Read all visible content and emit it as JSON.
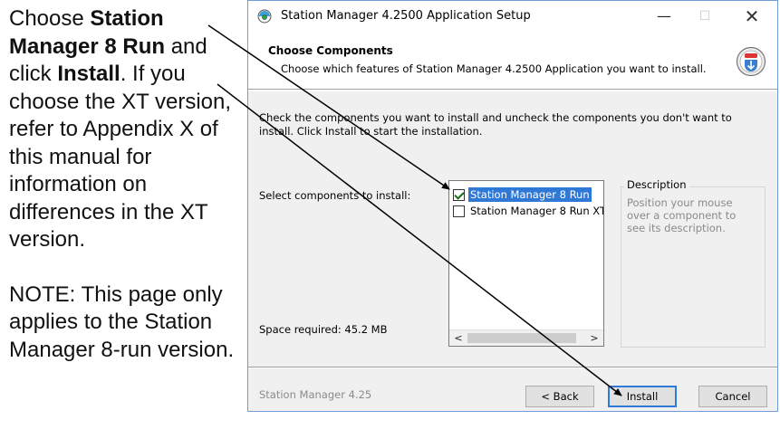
{
  "instructions": {
    "p1_part1": "Choose ",
    "p1_bold1": "Station Manager 8 Run",
    "p1_part2": " and click ",
    "p1_bold2": "Install",
    "p1_part3": ". If you choose the XT version, refer to Appendix X of this manual for information on differences in the XT version.",
    "note": "NOTE: This page only applies to the Station Manager 8-run version."
  },
  "window": {
    "title": "Station Manager 4.2500 Application Setup",
    "minimize": "—",
    "maximize": "☐",
    "close": "✕"
  },
  "header": {
    "title": "Choose Components",
    "subtitle": "Choose which features of Station Manager 4.2500 Application you want to install."
  },
  "body": {
    "instructions": "Check the components you want to install and uncheck the components you don't want to install. Click Install to start the installation.",
    "select_label": "Select components to install:",
    "space_required": "Space required: 45.2 MB",
    "components": [
      {
        "label": "Station Manager 8 Run",
        "checked": true,
        "selected": true
      },
      {
        "label": "Station Manager 8 Run XT",
        "checked": false,
        "selected": false
      }
    ],
    "scroll_left": "<",
    "scroll_right": ">",
    "description_title": "Description",
    "description_text": "Position your mouse over a component to see its description."
  },
  "footer": {
    "brand": "Station Manager 4.25",
    "back_label": "< Back",
    "install_label": "Install",
    "cancel_label": "Cancel"
  },
  "colors": {
    "selection": "#3078d6",
    "window_border": "#6e9fd6",
    "install_focus": "#2f7ad6"
  }
}
